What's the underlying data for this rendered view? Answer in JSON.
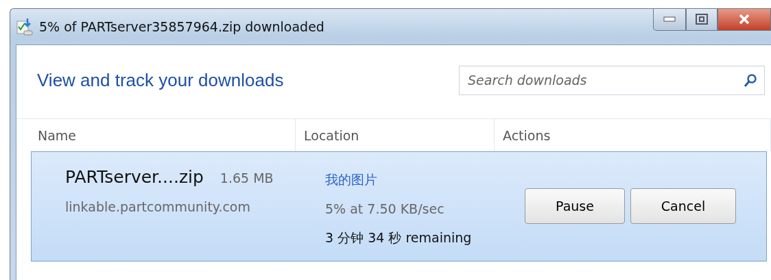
{
  "window": {
    "title": "5% of PARTserver35857964.zip downloaded"
  },
  "heading": "View and track your downloads",
  "search": {
    "placeholder": "Search downloads"
  },
  "columns": [
    "Name",
    "Location",
    "Actions"
  ],
  "downloads": [
    {
      "name": "PARTserver....zip",
      "size": "1.65 MB",
      "source": "linkable.partcommunity.com",
      "location": "我的图片",
      "progress": "5% at 7.50 KB/sec",
      "remaining": "3 分钟 34 秒 remaining",
      "selected": true,
      "actions": [
        "Pause",
        "Cancel"
      ]
    }
  ]
}
